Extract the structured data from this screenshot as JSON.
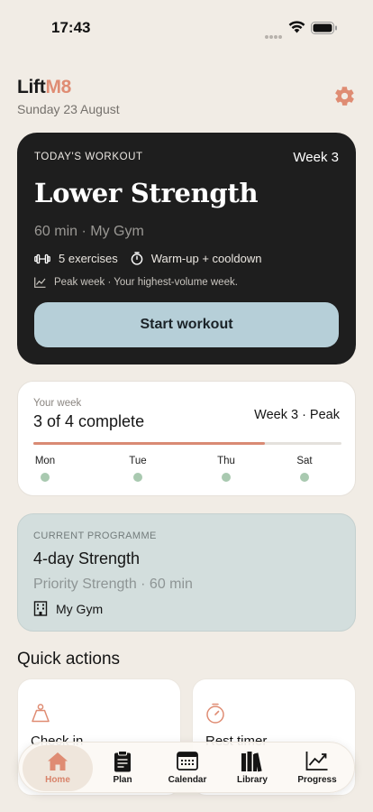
{
  "status_bar": {
    "time": "17:43"
  },
  "header": {
    "brand_main": "Lift",
    "brand_accent": "M8",
    "date": "Sunday 23 August"
  },
  "colors": {
    "accent": "#df8c73",
    "workout_card": "#1e1e1e",
    "start_button": "#b6cfd8",
    "programme_card": "#d3dedd",
    "progress_fill": "#d98a74",
    "day_dot": "#a9c9b0",
    "background": "#f1ece5"
  },
  "workout_card": {
    "label": "TODAY'S WORKOUT",
    "week": "Week 3",
    "title": "Lower Strength",
    "subtitle": "60 min · My Gym",
    "exercises": "5 exercises",
    "warmup": "Warm-up + cooldown",
    "note": "Peak week · Your highest-volume week.",
    "start_button": "Start workout",
    "icons": {
      "exercises": "dumbbell-icon",
      "warmup": "stopwatch-icon",
      "note": "trend-chart-icon"
    }
  },
  "week_card": {
    "label": "Your week",
    "count": "3 of 4 complete",
    "peak": "Week 3 · Peak",
    "progress": 0.75,
    "days": [
      {
        "name": "Mon"
      },
      {
        "name": "Tue"
      },
      {
        "name": "Thu"
      },
      {
        "name": "Sat"
      }
    ]
  },
  "programme_card": {
    "label": "CURRENT PROGRAMME",
    "title": "4-day Strength",
    "subtitle": "Priority Strength · 60 min",
    "gym": "My Gym",
    "gym_icon": "building-icon"
  },
  "quick_actions": {
    "heading": "Quick actions",
    "items": [
      {
        "label": "Check in",
        "icon": "weight-scale-icon"
      },
      {
        "label": "Rest timer",
        "icon": "timer-icon"
      }
    ]
  },
  "tab_bar": {
    "items": [
      {
        "label": "Home",
        "icon": "home-icon",
        "active": true
      },
      {
        "label": "Plan",
        "icon": "clipboard-icon",
        "active": false
      },
      {
        "label": "Calendar",
        "icon": "calendar-icon",
        "active": false
      },
      {
        "label": "Library",
        "icon": "books-icon",
        "active": false
      },
      {
        "label": "Progress",
        "icon": "chart-icon",
        "active": false
      }
    ]
  }
}
